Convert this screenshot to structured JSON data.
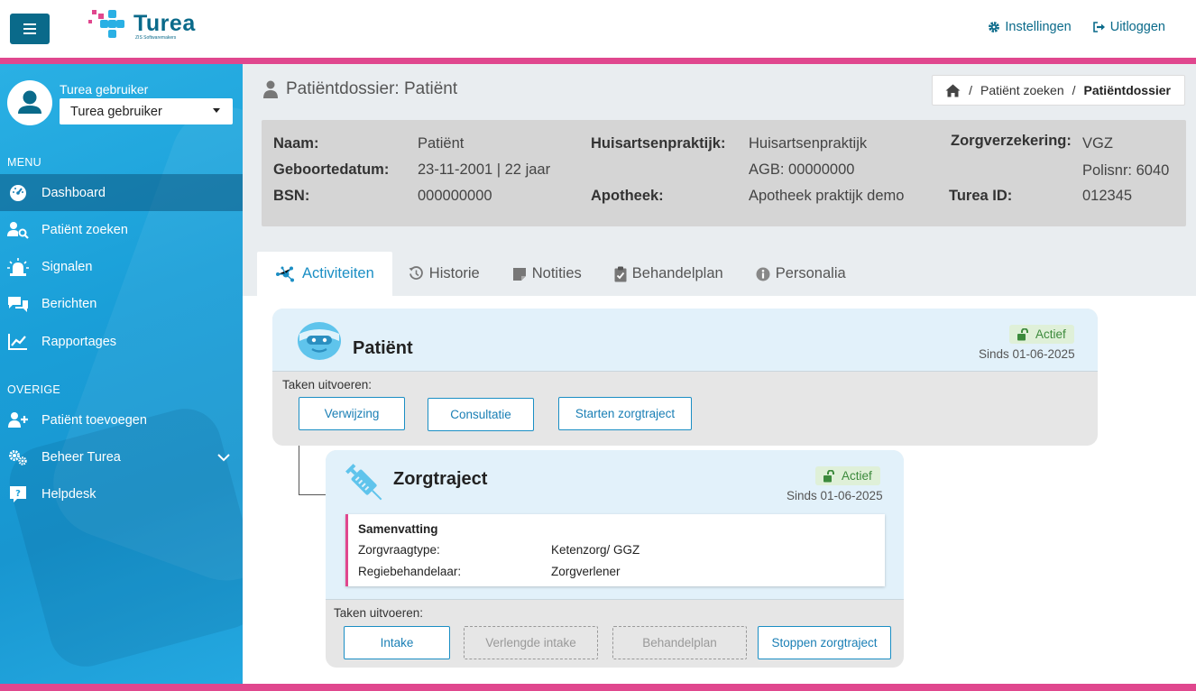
{
  "app": {
    "brand_name": "Turea",
    "brand_sub": "ZIS Softwaremakers"
  },
  "header": {
    "settings_label": "Instellingen",
    "logout_label": "Uitloggen"
  },
  "sidebar": {
    "user_name": "Turea gebruiker",
    "user_select_value": "Turea gebruiker",
    "menu_heading": "MENU",
    "menu_items": [
      {
        "label": "Dashboard",
        "icon": "dashboard-icon"
      },
      {
        "label": "Patiënt zoeken",
        "icon": "user-search-icon"
      },
      {
        "label": "Signalen",
        "icon": "alarm-icon"
      },
      {
        "label": "Berichten",
        "icon": "chat-icon"
      },
      {
        "label": "Rapportages",
        "icon": "chart-icon"
      }
    ],
    "other_heading": "OVERIGE",
    "other_items": [
      {
        "label": "Patiënt toevoegen",
        "icon": "user-add-icon"
      },
      {
        "label": "Beheer Turea",
        "icon": "gears-icon"
      },
      {
        "label": "Helpdesk",
        "icon": "question-icon"
      }
    ]
  },
  "page": {
    "title": "Patiëntdossier: Patiënt",
    "breadcrumb": [
      "Patiënt zoeken",
      "Patiëntdossier"
    ]
  },
  "patient_info": {
    "naam_label": "Naam:",
    "naam_value": "Patiënt",
    "geboortedatum_label": "Geboortedatum:",
    "geboortedatum_value": "23-11-2001 | 22 jaar",
    "bsn_label": "BSN:",
    "bsn_value": "000000000",
    "huisarts_label": "Huisartsenpraktijk:",
    "huisarts_value": "Huisartsenpraktijk",
    "agb_value": "AGB: 00000000",
    "apotheek_label": "Apotheek:",
    "apotheek_value": "Apotheek praktijk demo",
    "zorgverzekering_label": "Zorgverzekering:",
    "zorgverzekering_value": "VGZ",
    "polisnr_value": "Polisnr: 6040",
    "turea_id_label": "Turea ID:",
    "turea_id_value": "012345"
  },
  "tabs": [
    {
      "label": "Activiteiten",
      "icon": "network-icon"
    },
    {
      "label": "Historie",
      "icon": "history-icon"
    },
    {
      "label": "Notities",
      "icon": "note-icon"
    },
    {
      "label": "Behandelplan",
      "icon": "clipboard-check-icon"
    },
    {
      "label": "Personalia",
      "icon": "info-icon"
    }
  ],
  "patient_card": {
    "title": "Patiënt",
    "status": "Actief",
    "since": "Sinds 01-06-2025",
    "tasks_label": "Taken uitvoeren:",
    "buttons": [
      "Verwijzing",
      "Consultatie",
      "Starten zorgtraject"
    ]
  },
  "zorgtraject_card": {
    "title": "Zorgtraject",
    "status": "Actief",
    "since": "Sinds 01-06-2025",
    "summary_title": "Samenvatting",
    "summary_rows": [
      {
        "label": "Zorgvraagtype:",
        "value": "Ketenzorg/ GGZ"
      },
      {
        "label": "Regiebehandelaar:",
        "value": "Zorgverlener"
      }
    ],
    "tasks_label": "Taken uitvoeren:",
    "buttons": [
      "Intake",
      "Verlengde intake",
      "Behandelplan",
      "Stoppen zorgtraject"
    ]
  },
  "colors": {
    "brand": "#0a6a8a",
    "accent": "#1a8ec4",
    "pink": "#e0478e",
    "sidebar": "#1a9fd8",
    "active_green": "#3c8a3c"
  }
}
